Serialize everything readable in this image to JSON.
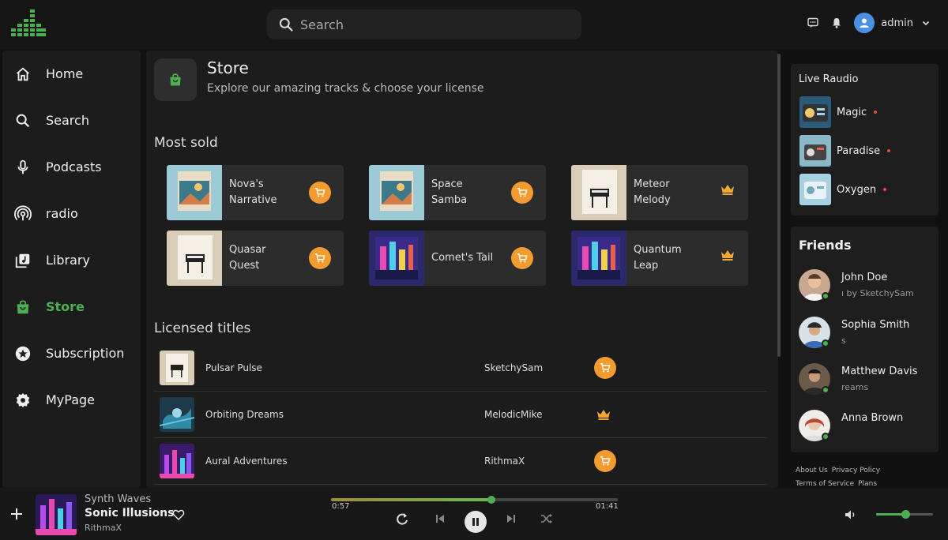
{
  "header": {
    "search_placeholder": "Search",
    "username": "admin"
  },
  "sidebar": {
    "items": [
      {
        "label": "Home",
        "icon": "home-icon"
      },
      {
        "label": "Search",
        "icon": "search-icon"
      },
      {
        "label": "Podcasts",
        "icon": "microphone-icon"
      },
      {
        "label": "radio",
        "icon": "radio-icon"
      },
      {
        "label": "Library",
        "icon": "library-icon"
      },
      {
        "label": "Store",
        "icon": "shopping-bag-icon",
        "active": true
      },
      {
        "label": "Subscription",
        "icon": "star-icon"
      },
      {
        "label": "MyPage",
        "icon": "gear-icon"
      }
    ]
  },
  "store": {
    "title": "Store",
    "subtitle": "Explore our amazing tracks & choose your license",
    "most_sold_title": "Most sold",
    "most_sold": [
      {
        "line1": "Nova's",
        "line2": "Narrative",
        "action": "cart"
      },
      {
        "line1": "Space",
        "line2": "Samba",
        "action": "cart"
      },
      {
        "line1": "Meteor",
        "line2": "Melody",
        "action": "crown"
      },
      {
        "line1": "Quasar",
        "line2": "Quest",
        "action": "cart"
      },
      {
        "line1": "Comet's Tail",
        "line2": "",
        "action": "cart"
      },
      {
        "line1": "Quantum",
        "line2": "Leap",
        "action": "crown"
      }
    ],
    "licensed_title": "Licensed titles",
    "licensed": [
      {
        "title": "Pulsar Pulse",
        "artist": "SketchySam",
        "action": "cart"
      },
      {
        "title": "Orbiting Dreams",
        "artist": "MelodicMike",
        "action": "crown"
      },
      {
        "title": "Aural Adventures",
        "artist": "RithmaX",
        "action": "cart"
      }
    ]
  },
  "live_radio": {
    "title": "Live Raudio",
    "stations": [
      {
        "name": "Magic"
      },
      {
        "name": "Paradise"
      },
      {
        "name": "Oxygen"
      }
    ]
  },
  "friends": {
    "title": "Friends",
    "list": [
      {
        "name": "John Doe",
        "sub": "ı by SketchySam"
      },
      {
        "name": "Sophia Smith",
        "sub": "s"
      },
      {
        "name": "Matthew Davis",
        "sub": "reams"
      },
      {
        "name": "Anna Brown",
        "sub": ""
      }
    ]
  },
  "footer": {
    "about": "About Us",
    "privacy": "Privacy Policy",
    "terms": "Terms of Service",
    "plans": "Plans"
  },
  "player": {
    "album": "Synth Waves",
    "title": "Sonic Illusions",
    "artist": "RithmaX",
    "current_time": "0:57",
    "total_time": "01:41",
    "progress": 0.56,
    "volume": 0.52
  },
  "colors": {
    "accent": "#4caf50",
    "cart": "#f29b2e",
    "crown": "#f0a830"
  }
}
